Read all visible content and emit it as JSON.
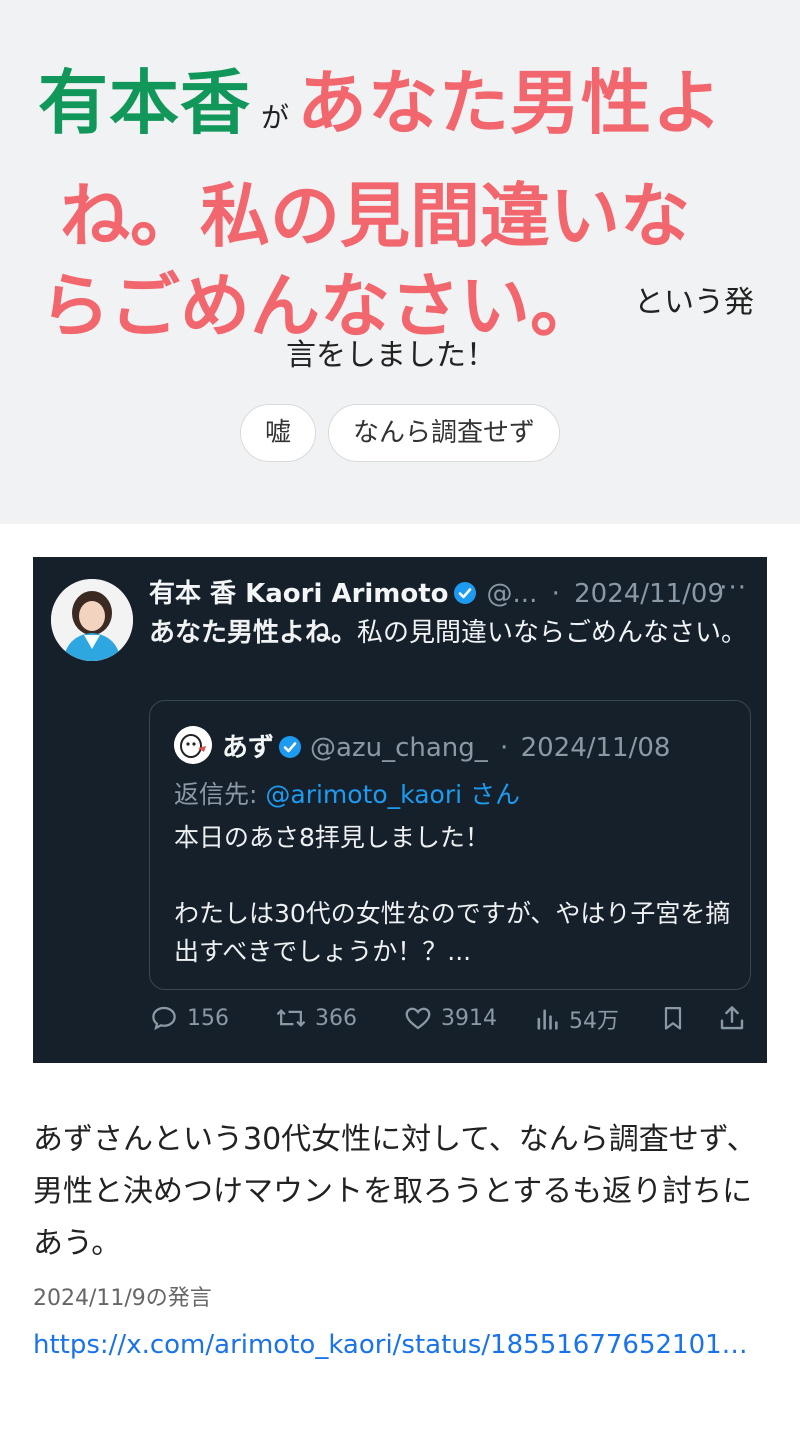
{
  "headline": {
    "speaker": "有本香",
    "particle": "が",
    "quote_line1": "あなた男性よ",
    "quote_line2": "ね。私の見間違いな",
    "quote_line3": "らごめんなさい。",
    "suffix_line1": "という発",
    "suffix_line2": "言をしました！",
    "colors": {
      "speaker": "#11975a",
      "quote": "#f2666e"
    }
  },
  "tags": [
    "嘘",
    "なんら調査せず"
  ],
  "tweet": {
    "author_name": "有本 香 Kaori Arimoto",
    "author_handle": "@...",
    "date": "2024/11/09",
    "more": "···",
    "text_bold": "あなた男性よね。",
    "text_rest": "私の見間違いならごめんなさい。",
    "quoted": {
      "name": "あず",
      "handle": "@azu_chang_",
      "date": "2024/11/08",
      "reply_prefix": "返信先:",
      "reply_to": "@arimoto_kaori",
      "reply_suffix": "さん",
      "body_line1": "本日のあさ8拝見しました！",
      "body_line2": "わたしは30代の女性なのですが、やはり子宮を摘出すべきでしょうか！？..."
    },
    "stats": {
      "replies": "156",
      "retweets": "366",
      "likes": "3914",
      "views": "54万"
    },
    "colors": {
      "background": "#15202b",
      "link": "#1d9bf0",
      "verified": "#1d9bf0"
    }
  },
  "description": "あずさんという30代女性に対して、なんら調査せず、男性と決めつけマウントを取ろうとするも返り討ちにあう。",
  "statement_date": "2024/11/9の発言",
  "source_link": "https://x.com/arimoto_kaori/status/1855167765210190..."
}
